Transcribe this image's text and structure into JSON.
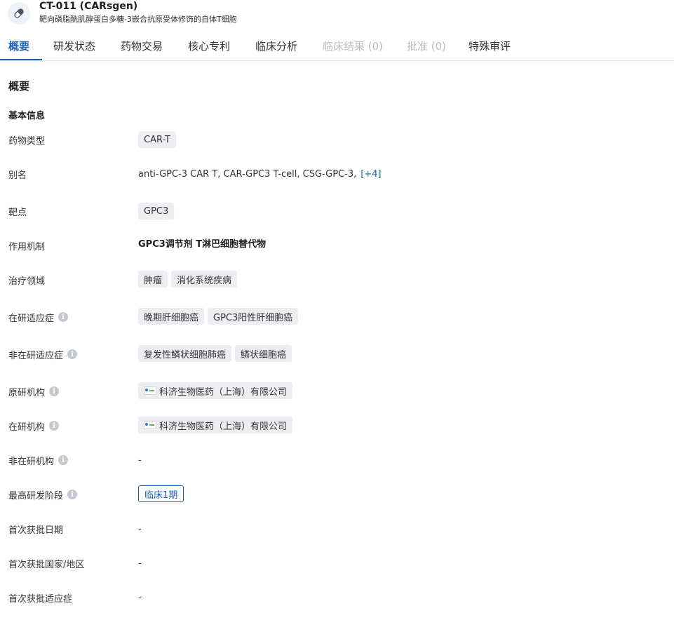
{
  "drug": {
    "name": "CT-011 (CARsgen)",
    "description": "靶向磷脂酰肌醇蛋白多糖-3嵌合抗原受体修饰的自体T细胞"
  },
  "tabs": [
    {
      "label": "概要"
    },
    {
      "label": "研发状态"
    },
    {
      "label": "药物交易"
    },
    {
      "label": "核心专利"
    },
    {
      "label": "临床分析"
    },
    {
      "label": "临床结果 (0)"
    },
    {
      "label": "批准 (0)"
    },
    {
      "label": "特殊审评"
    }
  ],
  "overview": {
    "title": "概要",
    "basic_info_title": "基本信息",
    "labels": {
      "drug_type": "药物类型",
      "alias": "别名",
      "target": "靶点",
      "mechanism": "作用机制",
      "therapeutic_area": "治疗领域",
      "active_indication": "在研适应症",
      "inactive_indication": "非在研适应症",
      "originator": "原研机构",
      "active_org": "在研机构",
      "inactive_org": "非在研机构",
      "highest_phase": "最高研发阶段",
      "first_approval_date": "首次获批日期",
      "first_approval_country": "首次获批国家/地区",
      "first_approval_indication": "首次获批适应症"
    },
    "values": {
      "drug_type": "CAR-T",
      "alias": "anti-GPC-3 CAR T,  CAR-GPC3 T-cell,  CSG-GPC-3,",
      "alias_more": "[+4]",
      "target": "GPC3",
      "mechanism": "GPC3调节剂  T淋巴细胞替代物",
      "therapeutic_area": [
        "肿瘤",
        "消化系统疾病"
      ],
      "active_indication": [
        "晚期肝细胞癌",
        "GPC3阳性肝细胞癌"
      ],
      "inactive_indication": [
        "复发性鳞状细胞肺癌",
        "鳞状细胞癌"
      ],
      "originator": "科济生物医药（上海）有限公司",
      "active_org": "科济生物医药（上海）有限公司",
      "inactive_org": "-",
      "highest_phase": "临床1期",
      "first_approval_date": "-",
      "first_approval_country": "-",
      "first_approval_indication": "-"
    }
  },
  "colors": {
    "accent": "#1e63b6",
    "tag_bg": "#eceef1",
    "disabled": "#b8bcc4"
  },
  "icons": {
    "drug_badge": "pill-icon",
    "info": "info-icon",
    "org_logo": "company-logo-icon"
  }
}
